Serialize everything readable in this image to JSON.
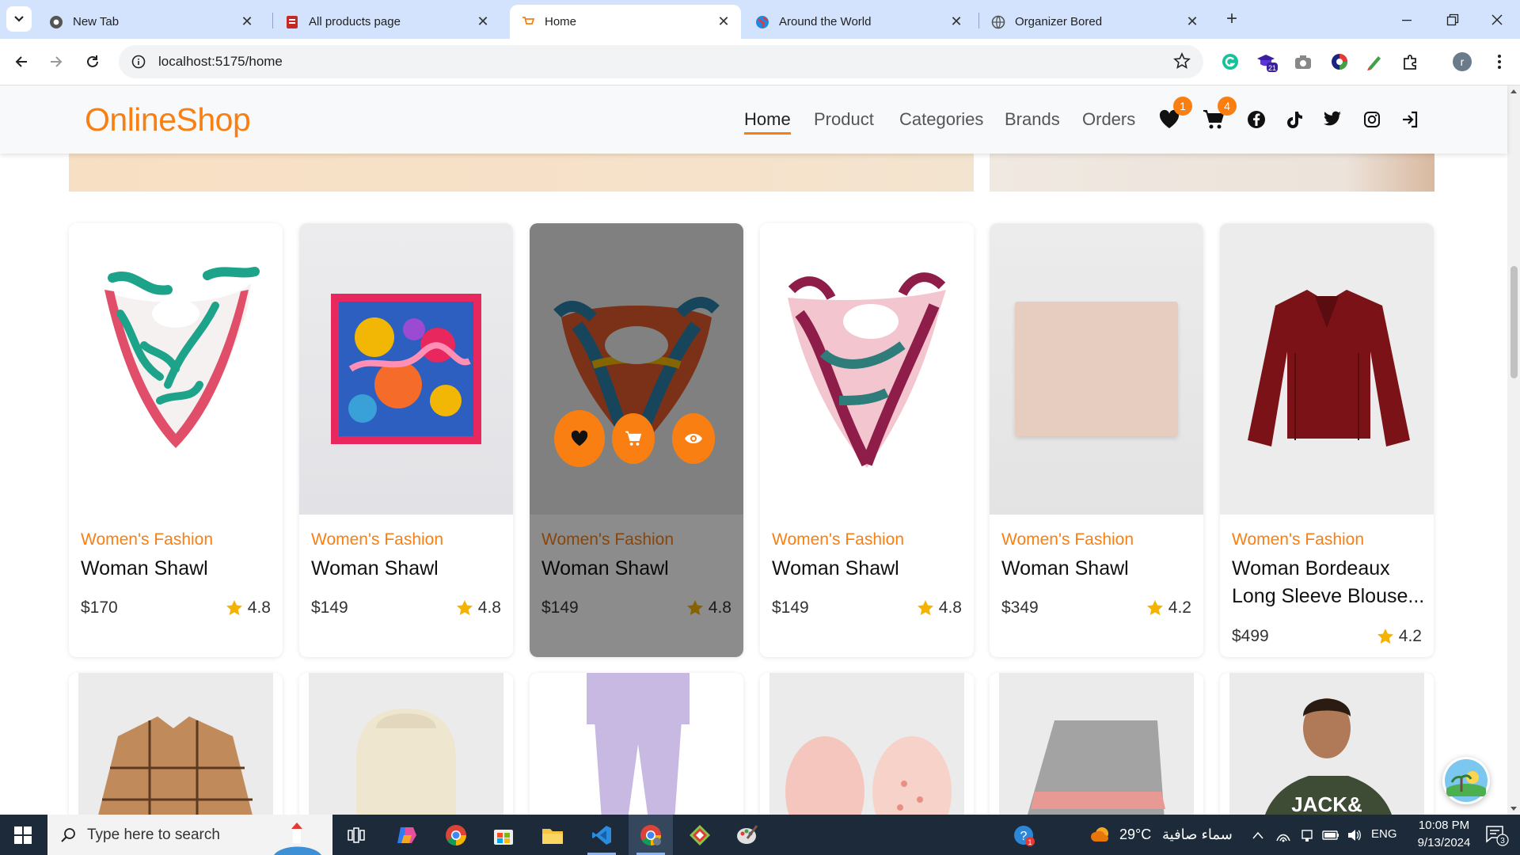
{
  "browser": {
    "tabs": [
      {
        "title": "New Tab",
        "icon": "chrome-icon"
      },
      {
        "title": "All products page",
        "icon": "page-icon"
      },
      {
        "title": "Home",
        "icon": "cart-favicon"
      },
      {
        "title": "Around the World",
        "icon": "globe-icon"
      },
      {
        "title": "Organizer Bored",
        "icon": "globe-icon"
      }
    ],
    "active_tab": 2,
    "url": "localhost:5175/home",
    "extension_badge": "21",
    "profile_initial": "r"
  },
  "site": {
    "logo": "OnlineShop",
    "brand_color": "#f97f12",
    "nav": [
      "Home",
      "Product",
      "Categories",
      "Brands",
      "Orders"
    ],
    "active_nav": "Home",
    "wishlist_count": "1",
    "cart_count": "4",
    "social_icons": [
      "facebook-icon",
      "tiktok-icon",
      "twitter-icon",
      "instagram-icon",
      "login-icon"
    ]
  },
  "products": [
    {
      "category": "Women's Fashion",
      "name": "Woman Shawl",
      "price": "$170",
      "rating": "4.8"
    },
    {
      "category": "Women's Fashion",
      "name": "Woman Shawl",
      "price": "$149",
      "rating": "4.8"
    },
    {
      "category": "Women's Fashion",
      "name": "Woman Shawl",
      "price": "$149",
      "rating": "4.8"
    },
    {
      "category": "Women's Fashion",
      "name": "Woman Shawl",
      "price": "$149",
      "rating": "4.8"
    },
    {
      "category": "Women's Fashion",
      "name": "Woman Shawl",
      "price": "$349",
      "rating": "4.2"
    },
    {
      "category": "Women's Fashion",
      "name": "Woman Bordeaux Long Sleeve Blouse...",
      "price": "$499",
      "rating": "4.2"
    }
  ],
  "hovered_product": 2,
  "taskbar": {
    "search_placeholder": "Type here to search",
    "weather_temp": "29°C",
    "weather_desc": "سماء صافية",
    "language": "ENG",
    "time": "10:08 PM",
    "date": "9/13/2024",
    "notification_count": "3",
    "help_badge": "1"
  }
}
